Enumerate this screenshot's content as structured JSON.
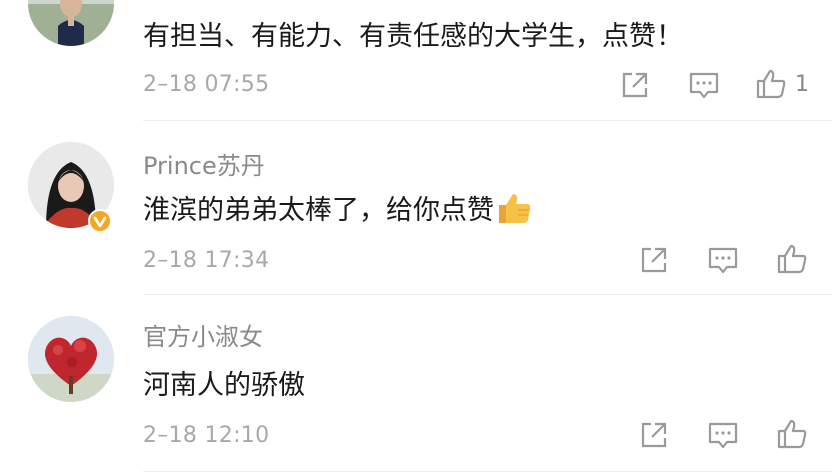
{
  "comments": [
    {
      "username": "",
      "content": "有担当、有能力、有责任感的大学生，点赞！",
      "time": "2–18 07:55",
      "like_count": "1"
    },
    {
      "username": "Prince苏丹",
      "content": "淮滨的弟弟太棒了，给你点赞",
      "emoji": "thumbs-up-emoji",
      "verified": true,
      "time": "2–18 17:34",
      "like_count": ""
    },
    {
      "username": "官方小淑女",
      "content": "河南人的骄傲",
      "time": "2–18 12:10",
      "like_count": ""
    }
  ],
  "icons": [
    "share-icon",
    "reply-icon",
    "like-icon",
    "verified-badge-icon"
  ],
  "colors": {
    "text_primary": "#1a1a1a",
    "text_secondary": "#8a8a8a",
    "timestamp": "#a8a8a8",
    "icon": "#9a9a9a",
    "verified_badge": "#f5a623",
    "divider": "#ececec"
  }
}
